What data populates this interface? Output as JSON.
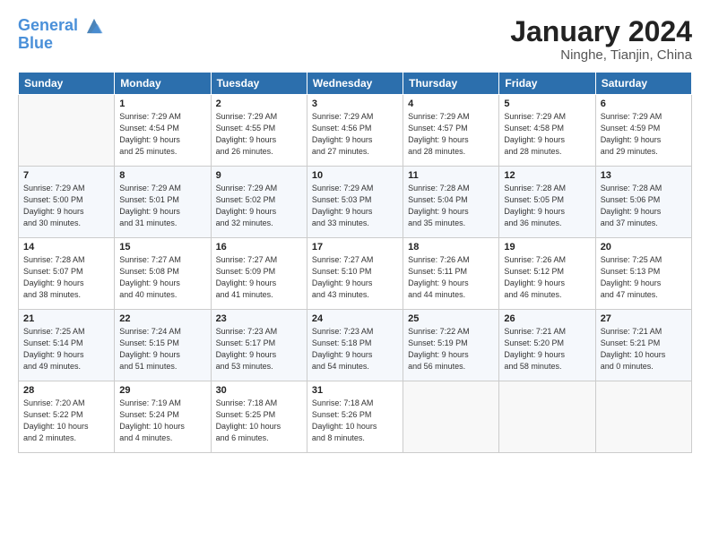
{
  "logo": {
    "line1": "General",
    "line2": "Blue"
  },
  "title": "January 2024",
  "location": "Ninghe, Tianjin, China",
  "days_header": [
    "Sunday",
    "Monday",
    "Tuesday",
    "Wednesday",
    "Thursday",
    "Friday",
    "Saturday"
  ],
  "weeks": [
    [
      {
        "day": "",
        "info": ""
      },
      {
        "day": "1",
        "info": "Sunrise: 7:29 AM\nSunset: 4:54 PM\nDaylight: 9 hours\nand 25 minutes."
      },
      {
        "day": "2",
        "info": "Sunrise: 7:29 AM\nSunset: 4:55 PM\nDaylight: 9 hours\nand 26 minutes."
      },
      {
        "day": "3",
        "info": "Sunrise: 7:29 AM\nSunset: 4:56 PM\nDaylight: 9 hours\nand 27 minutes."
      },
      {
        "day": "4",
        "info": "Sunrise: 7:29 AM\nSunset: 4:57 PM\nDaylight: 9 hours\nand 28 minutes."
      },
      {
        "day": "5",
        "info": "Sunrise: 7:29 AM\nSunset: 4:58 PM\nDaylight: 9 hours\nand 28 minutes."
      },
      {
        "day": "6",
        "info": "Sunrise: 7:29 AM\nSunset: 4:59 PM\nDaylight: 9 hours\nand 29 minutes."
      }
    ],
    [
      {
        "day": "7",
        "info": "Sunrise: 7:29 AM\nSunset: 5:00 PM\nDaylight: 9 hours\nand 30 minutes."
      },
      {
        "day": "8",
        "info": "Sunrise: 7:29 AM\nSunset: 5:01 PM\nDaylight: 9 hours\nand 31 minutes."
      },
      {
        "day": "9",
        "info": "Sunrise: 7:29 AM\nSunset: 5:02 PM\nDaylight: 9 hours\nand 32 minutes."
      },
      {
        "day": "10",
        "info": "Sunrise: 7:29 AM\nSunset: 5:03 PM\nDaylight: 9 hours\nand 33 minutes."
      },
      {
        "day": "11",
        "info": "Sunrise: 7:28 AM\nSunset: 5:04 PM\nDaylight: 9 hours\nand 35 minutes."
      },
      {
        "day": "12",
        "info": "Sunrise: 7:28 AM\nSunset: 5:05 PM\nDaylight: 9 hours\nand 36 minutes."
      },
      {
        "day": "13",
        "info": "Sunrise: 7:28 AM\nSunset: 5:06 PM\nDaylight: 9 hours\nand 37 minutes."
      }
    ],
    [
      {
        "day": "14",
        "info": "Sunrise: 7:28 AM\nSunset: 5:07 PM\nDaylight: 9 hours\nand 38 minutes."
      },
      {
        "day": "15",
        "info": "Sunrise: 7:27 AM\nSunset: 5:08 PM\nDaylight: 9 hours\nand 40 minutes."
      },
      {
        "day": "16",
        "info": "Sunrise: 7:27 AM\nSunset: 5:09 PM\nDaylight: 9 hours\nand 41 minutes."
      },
      {
        "day": "17",
        "info": "Sunrise: 7:27 AM\nSunset: 5:10 PM\nDaylight: 9 hours\nand 43 minutes."
      },
      {
        "day": "18",
        "info": "Sunrise: 7:26 AM\nSunset: 5:11 PM\nDaylight: 9 hours\nand 44 minutes."
      },
      {
        "day": "19",
        "info": "Sunrise: 7:26 AM\nSunset: 5:12 PM\nDaylight: 9 hours\nand 46 minutes."
      },
      {
        "day": "20",
        "info": "Sunrise: 7:25 AM\nSunset: 5:13 PM\nDaylight: 9 hours\nand 47 minutes."
      }
    ],
    [
      {
        "day": "21",
        "info": "Sunrise: 7:25 AM\nSunset: 5:14 PM\nDaylight: 9 hours\nand 49 minutes."
      },
      {
        "day": "22",
        "info": "Sunrise: 7:24 AM\nSunset: 5:15 PM\nDaylight: 9 hours\nand 51 minutes."
      },
      {
        "day": "23",
        "info": "Sunrise: 7:23 AM\nSunset: 5:17 PM\nDaylight: 9 hours\nand 53 minutes."
      },
      {
        "day": "24",
        "info": "Sunrise: 7:23 AM\nSunset: 5:18 PM\nDaylight: 9 hours\nand 54 minutes."
      },
      {
        "day": "25",
        "info": "Sunrise: 7:22 AM\nSunset: 5:19 PM\nDaylight: 9 hours\nand 56 minutes."
      },
      {
        "day": "26",
        "info": "Sunrise: 7:21 AM\nSunset: 5:20 PM\nDaylight: 9 hours\nand 58 minutes."
      },
      {
        "day": "27",
        "info": "Sunrise: 7:21 AM\nSunset: 5:21 PM\nDaylight: 10 hours\nand 0 minutes."
      }
    ],
    [
      {
        "day": "28",
        "info": "Sunrise: 7:20 AM\nSunset: 5:22 PM\nDaylight: 10 hours\nand 2 minutes."
      },
      {
        "day": "29",
        "info": "Sunrise: 7:19 AM\nSunset: 5:24 PM\nDaylight: 10 hours\nand 4 minutes."
      },
      {
        "day": "30",
        "info": "Sunrise: 7:18 AM\nSunset: 5:25 PM\nDaylight: 10 hours\nand 6 minutes."
      },
      {
        "day": "31",
        "info": "Sunrise: 7:18 AM\nSunset: 5:26 PM\nDaylight: 10 hours\nand 8 minutes."
      },
      {
        "day": "",
        "info": ""
      },
      {
        "day": "",
        "info": ""
      },
      {
        "day": "",
        "info": ""
      }
    ]
  ]
}
